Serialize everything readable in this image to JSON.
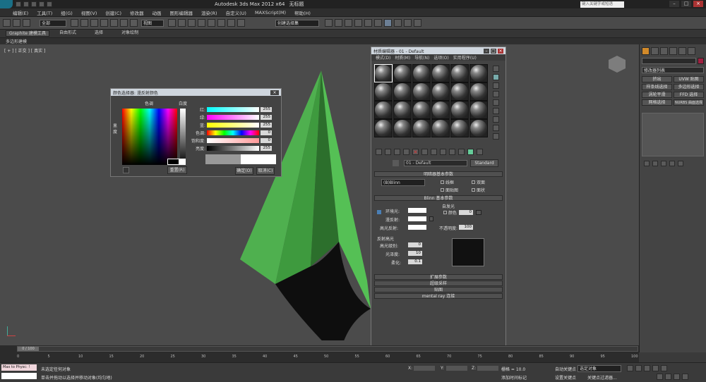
{
  "app": {
    "title": "Autodesk 3ds Max  2012 x64",
    "subtitle": "无标题",
    "search_placeholder": "键入关键字或短语"
  },
  "menu": [
    "编辑(E)",
    "工具(T)",
    "组(G)",
    "视图(V)",
    "创建(C)",
    "修改器",
    "动画",
    "图形编辑器",
    "渲染(R)",
    "自定义(U)",
    "MAXScript(M)",
    "帮助(H)"
  ],
  "toolbar": {
    "filter": "全部",
    "view": "视图",
    "named_selection": "创建选择集"
  },
  "ribbon": {
    "tabs": [
      "Graphite 建模工具",
      "自由形式",
      "选择",
      "对象绘制"
    ],
    "sub": "多边形建模"
  },
  "viewport": {
    "label": "[ + ] [ 正交 ] [ 真实 ]"
  },
  "color_dialog": {
    "title": "颜色选择器: 漫反射颜色",
    "hue_label": "色调",
    "white_label": "白度",
    "black_label": "黑度",
    "channels": [
      {
        "label": "红:",
        "value": "255"
      },
      {
        "label": "绿:",
        "value": "255"
      },
      {
        "label": "蓝:",
        "value": "255"
      },
      {
        "label": "色调:",
        "value": "0"
      },
      {
        "label": "饱和度:",
        "value": "0"
      },
      {
        "label": "亮度:",
        "value": "255"
      }
    ],
    "reset": "重置(R)",
    "ok": "确定(O)",
    "cancel": "取消(C)"
  },
  "material_editor": {
    "title": "材质编辑器 - 01 - Default",
    "menu": [
      "模式(D)",
      "材质(M)",
      "导航(N)",
      "选项(O)",
      "实用程序(U)"
    ],
    "material_name": "01 - Default",
    "material_type": "Standard",
    "shader_rollout": "明暗器基本参数",
    "shader": "(B)Blinn",
    "checks": [
      "线框",
      "双面",
      "面贴图",
      "面状"
    ],
    "blinn_rollout": "Blinn 基本参数",
    "self_illum": "自发光",
    "color_label": "颜色",
    "color_value": "0",
    "ambient": "环境光:",
    "diffuse": "漫反射:",
    "specular": "高光反射:",
    "opacity_label": "不透明度:",
    "opacity_value": "100",
    "spec_highlights": "反射高光",
    "spec_level_label": "高光级别:",
    "spec_level": "0",
    "gloss_label": "光泽度:",
    "gloss": "10",
    "soften_label": "柔化:",
    "soften": "0.1",
    "rollouts": [
      "扩展参数",
      "超级采样",
      "贴图",
      "mental ray 连接"
    ]
  },
  "command_panel": {
    "object_name": "",
    "modifier_list": "修改器列表",
    "buttons": [
      "挤出",
      "UVW 贴图",
      "样条线选择",
      "多边形选择",
      "涡轮平滑",
      "FFD 选择",
      "网格选择",
      "NURBS 曲面选择"
    ]
  },
  "timeline": {
    "frame": "0 / 100",
    "ticks": [
      "0",
      "5",
      "10",
      "15",
      "20",
      "25",
      "30",
      "35",
      "40",
      "45",
      "50",
      "55",
      "60",
      "65",
      "70",
      "75",
      "80",
      "85",
      "90",
      "95",
      "100"
    ]
  },
  "status": {
    "script": "Max to Physc: !",
    "line1": "未选定任何对象",
    "line2": "单击并拖动以选择并移动对象(均匀地)",
    "x": "X:",
    "y": "Y:",
    "z": "Z:",
    "grid": "栅格 = 10.0",
    "auto_key": "自动关键点",
    "selected": "选定对象",
    "set_key": "设置关键点",
    "key_filter": "关键点过滤器...",
    "add_time_tag": "添加时间标记"
  }
}
